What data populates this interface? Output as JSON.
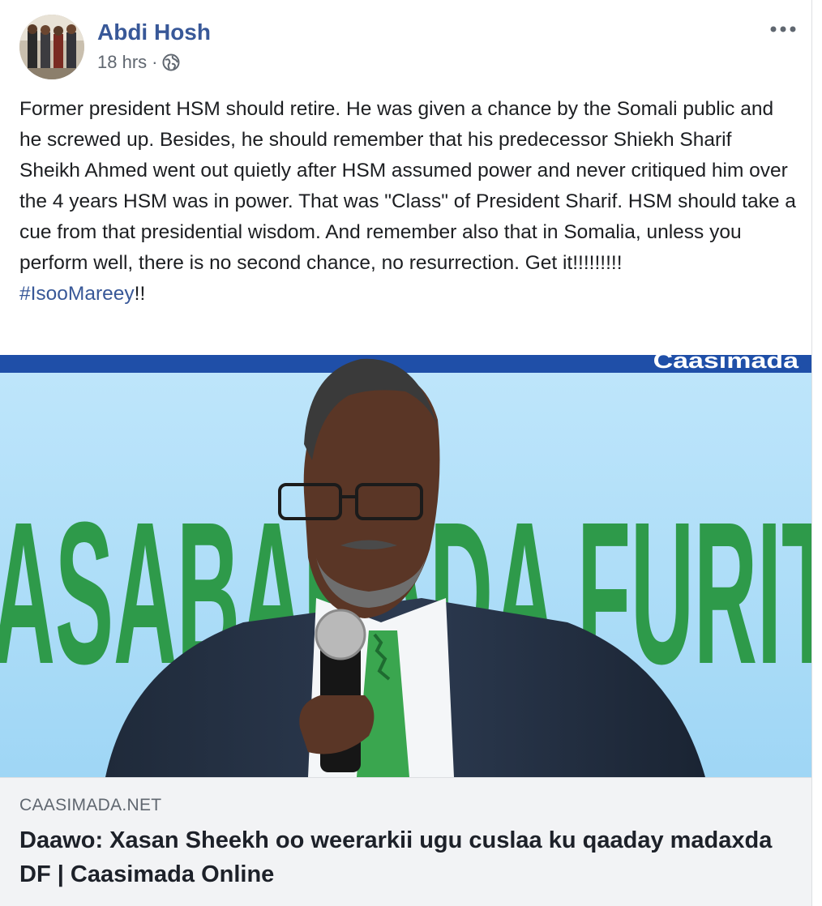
{
  "post": {
    "author": "Abdi Hosh",
    "timestamp": "18 hrs",
    "separator": "·",
    "privacy_icon": "globe-icon",
    "more_icon": "more-options-icon",
    "text": "Former president HSM should retire. He was given a chance by the Somali public and he screwed up. Besides, he should remember that his predecessor Shiekh Sharif Sheikh Ahmed went out quietly after HSM assumed power and never critiqued him over the 4 years HSM was in power. That was \"Class\" of President Sharif. HSM should take a cue from that presidential wisdom. And remember also that in Somalia, unless you perform well, there is no second chance, no resurrection. Get it!!!!!!!!!",
    "hashtag": "#IsooMareey",
    "hashtag_suffix": "!!"
  },
  "link_preview": {
    "banner_text": "ASABAHADA FURIT",
    "watermark": "Caasimada",
    "domain": "CAASIMADA.NET",
    "title": "Daawo: Xasan Sheekh oo weerarkii ugu cuslaa ku qaaday madaxda DF | Caasimada Online"
  },
  "colors": {
    "link_blue": "#385898",
    "meta_gray": "#606770",
    "caption_bg": "#f2f3f5",
    "banner_green": "#2e9a4a"
  }
}
